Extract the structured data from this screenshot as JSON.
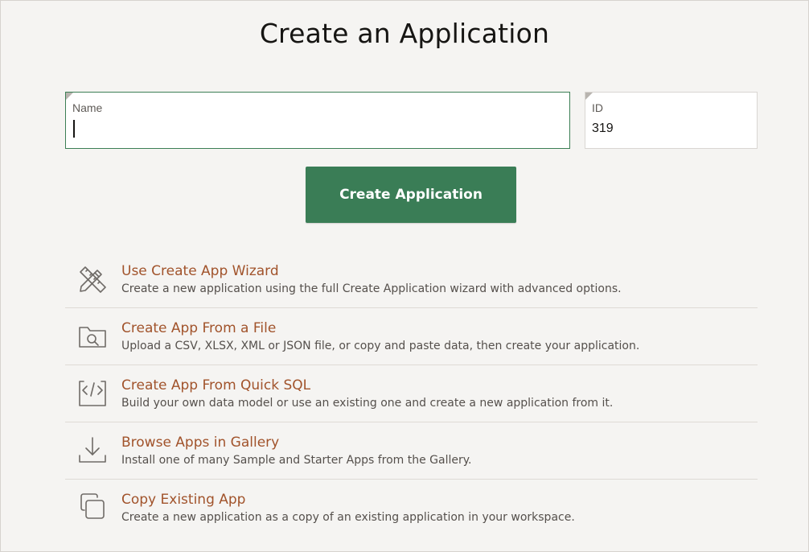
{
  "page": {
    "title": "Create an Application"
  },
  "form": {
    "name_label": "Name",
    "name_value": "",
    "id_label": "ID",
    "id_value": "319"
  },
  "primary_action": {
    "label": "Create Application"
  },
  "options": [
    {
      "icon": "pencil-ruler-icon",
      "title": "Use Create App Wizard",
      "description": "Create a new application using the full Create Application wizard with advanced options."
    },
    {
      "icon": "folder-search-icon",
      "title": "Create App From a File",
      "description": "Upload a CSV, XLSX, XML or JSON file, or copy and paste data, then create your application."
    },
    {
      "icon": "code-window-icon",
      "title": "Create App From Quick SQL",
      "description": "Build your own data model or use an existing one and create a new application from it."
    },
    {
      "icon": "download-tray-icon",
      "title": "Browse Apps in Gallery",
      "description": "Install one of many Sample and Starter Apps from the Gallery."
    },
    {
      "icon": "copy-icon",
      "title": "Copy Existing App",
      "description": "Create a new application as a copy of an existing application in your workspace."
    }
  ],
  "colors": {
    "accent_green": "#3a7d56",
    "link_rust": "#a1532b",
    "background": "#f5f4f2"
  }
}
